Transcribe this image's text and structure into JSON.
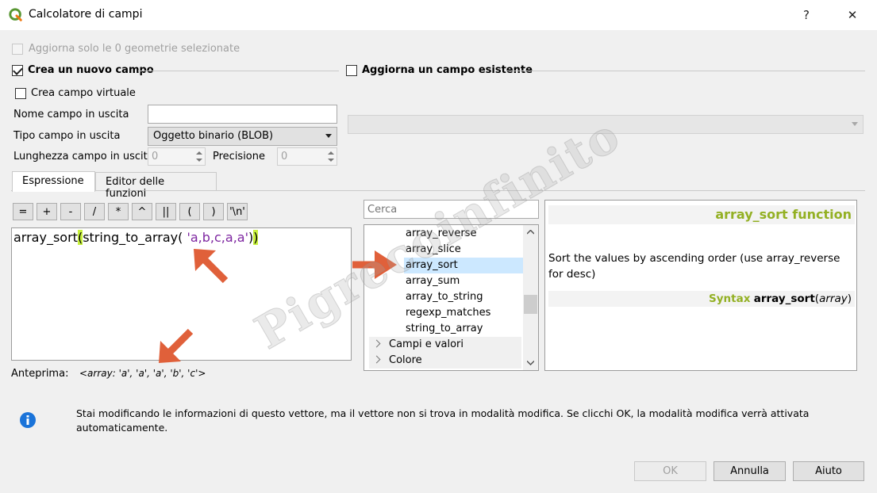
{
  "window": {
    "title": "Calcolatore di campi",
    "help_glyph": "?",
    "close_glyph": "✕"
  },
  "selection": {
    "label": "Aggiorna solo le 0 geometrie selezionate"
  },
  "new_field": {
    "section_label": "Crea un nuovo campo",
    "virtual_label": "Crea campo virtuale",
    "name_label": "Nome campo in uscita",
    "name_value": "",
    "type_label": "Tipo campo in uscita",
    "type_value": "Oggetto binario (BLOB)",
    "length_label": "Lunghezza campo in uscita",
    "length_value": "0",
    "precision_label": "Precisione",
    "precision_value": "0"
  },
  "existing_field": {
    "section_label": "Aggiorna un campo esistente",
    "combo_value": ""
  },
  "tabs": [
    {
      "label": "Espressione"
    },
    {
      "label": "Editor delle funzioni"
    }
  ],
  "operators": [
    "=",
    "+",
    "-",
    "/",
    "*",
    "^",
    "||",
    "(",
    ")",
    "'\\n'"
  ],
  "expression": {
    "func": "array_sort",
    "open1": "(",
    "inner": "string_to_array( ",
    "string": "'a,b,c,a,a'",
    "close1": ")",
    "close2": ")"
  },
  "preview": {
    "label": "Anteprima:",
    "value": "<array: 'a', 'a', 'a', 'b', 'c'>"
  },
  "search": {
    "placeholder": "Cerca"
  },
  "function_list": {
    "items": [
      "array_reverse",
      "array_slice",
      "array_sort",
      "array_sum",
      "array_to_string",
      "regexp_matches",
      "string_to_array"
    ],
    "selected": "array_sort",
    "groups": [
      "Campi e valori",
      "Colore"
    ]
  },
  "help": {
    "title": "array_sort function",
    "description": "Sort the values by ascending order (use array_reverse for desc)",
    "syntax_label": "Syntax",
    "syntax_func": "array_sort",
    "syntax_open": "(",
    "syntax_arg": "array",
    "syntax_close": ")"
  },
  "info": {
    "message": "Stai modificando le informazioni di questo vettore, ma il vettore non si trova in modalità modifica. Se clicchi OK, la modalità modifica verrà attivata automaticamente."
  },
  "buttons": {
    "ok": "OK",
    "cancel": "Annulla",
    "help": "Aiuto"
  },
  "watermark": "Pigrecoinfinito",
  "colors": {
    "accent_green": "#93b023",
    "highlight": "#c8f23d",
    "string": "#7d25a0",
    "arrow": "#e0603a",
    "info_blue": "#1a73d9"
  }
}
